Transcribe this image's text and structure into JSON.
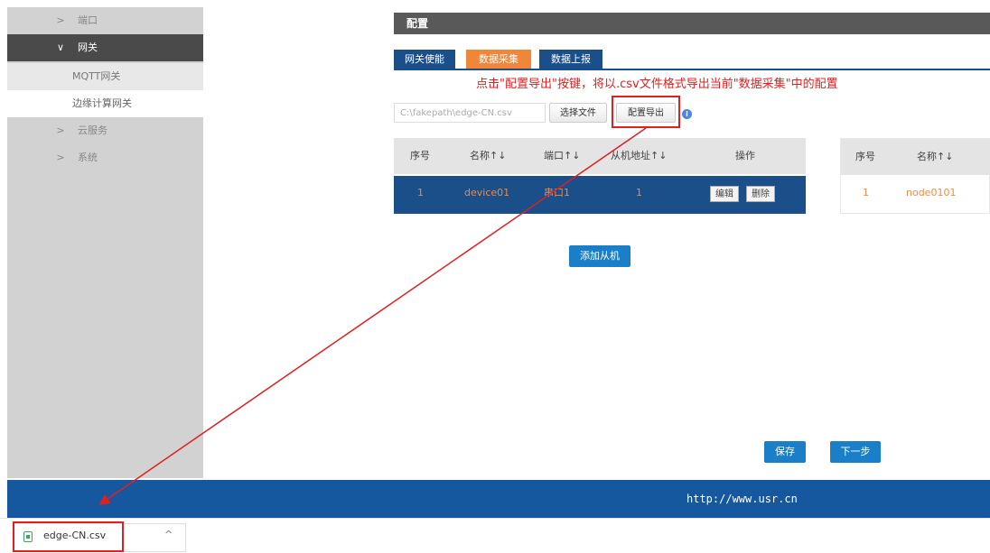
{
  "sidebar": {
    "items": [
      {
        "label": "端口",
        "chevron": ">"
      },
      {
        "label": "网关",
        "chevron": "∨"
      },
      {
        "label": "MQTT网关"
      },
      {
        "label": "边缘计算网关"
      },
      {
        "label": "云服务",
        "chevron": ">"
      },
      {
        "label": "系统",
        "chevron": ">"
      }
    ]
  },
  "header": {
    "title": "配置"
  },
  "tabs": [
    {
      "label": "网关使能"
    },
    {
      "label": "数据采集"
    },
    {
      "label": "数据上报"
    }
  ],
  "instruction": "点击\"配置导出\"按键，将以.csv文件格式导出当前\"数据采集\"中的配置",
  "file": {
    "value": "C:\\fakepath\\edge-CN.csv",
    "choose_label": "选择文件",
    "export_label": "配置导出",
    "info_icon": "info-icon"
  },
  "slave_table": {
    "headers": [
      "序号",
      "名称↑↓",
      "端口↑↓",
      "从机地址↑↓",
      "操作"
    ],
    "rows": [
      {
        "index": "1",
        "name": "device01",
        "port": "串口1",
        "address": "1",
        "edit": "编辑",
        "delete": "删除"
      }
    ]
  },
  "node_table": {
    "headers": [
      "序号",
      "名称↑↓"
    ],
    "rows": [
      {
        "index": "1",
        "name": "node0101"
      }
    ]
  },
  "add_slave_label": "添加从机",
  "save_label": "保存",
  "next_label": "下一步",
  "footer_url": "http://www.usr.cn",
  "download": {
    "filename": "edge-CN.csv",
    "chevron": "^"
  },
  "colors": {
    "accent_blue": "#1a4f8a",
    "orange": "#f0863a",
    "annotation_red": "#e02020",
    "footer_blue": "#1558a0"
  }
}
